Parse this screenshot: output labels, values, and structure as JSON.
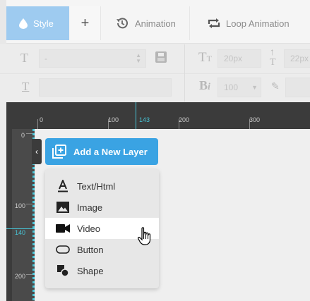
{
  "tabs": {
    "style": "Style",
    "add": "+",
    "animation": "Animation",
    "loop_animation": "Loop Animation"
  },
  "toolbar": {
    "row1": {
      "font_family_value": "-",
      "font_size_value": "20px",
      "line_height_value": "22px"
    },
    "row2": {
      "font_weight_value": "100"
    }
  },
  "ruler": {
    "labels": [
      "0",
      "100",
      "200",
      "300"
    ],
    "cursor_value": "143"
  },
  "vruler": {
    "labels": [
      "0",
      "100",
      "200"
    ],
    "cursor_value": "140"
  },
  "layer_menu": {
    "add_button": "Add a New Layer",
    "items": [
      {
        "label": "Text/Html",
        "icon": "text-icon"
      },
      {
        "label": "Image",
        "icon": "image-icon"
      },
      {
        "label": "Video",
        "icon": "video-icon"
      },
      {
        "label": "Button",
        "icon": "button-icon"
      },
      {
        "label": "Shape",
        "icon": "shape-icon"
      }
    ],
    "highlighted_index": 2
  },
  "colors": {
    "active_tab": "#9ecbf0",
    "accent_button": "#3aa3e3",
    "ruler_bg": "#3b3b3b",
    "cursor": "#47c4d6"
  }
}
